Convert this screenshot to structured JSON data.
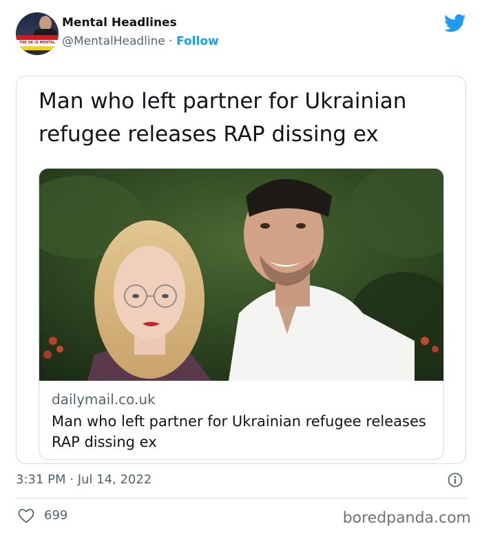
{
  "author": {
    "display_name": "Mental Headlines",
    "handle": "@MentalHeadline",
    "separator": "·",
    "follow_label": "Follow",
    "avatar_text": "THE UK IS MENTAL"
  },
  "tweet": {
    "headline": "Man who left partner for Ukrainian refugee releases RAP dissing ex",
    "link_card": {
      "domain": "dailymail.co.uk",
      "title": "Man who left partner for Ukrainian refugee releases RAP dissing ex"
    },
    "timestamp": "3:31 PM · Jul 14, 2022",
    "likes": "699"
  },
  "icons": {
    "brand": "twitter-bird-icon",
    "info": "info-icon",
    "like": "heart-icon"
  },
  "colors": {
    "accent": "#1d9bf0",
    "text_primary": "#0f1419",
    "text_secondary": "#536471",
    "border": "#cfd9de"
  },
  "watermark": "boredpanda.com"
}
